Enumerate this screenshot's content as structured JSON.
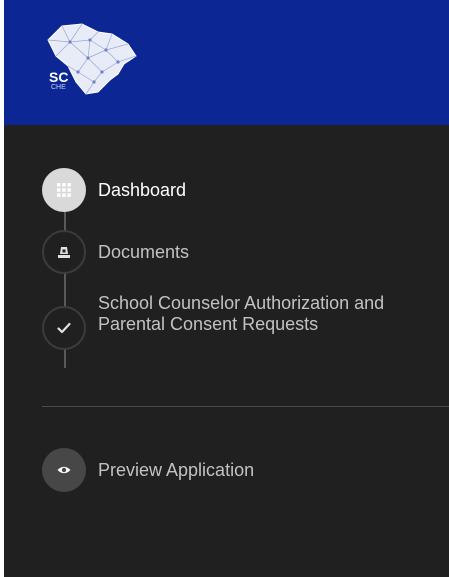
{
  "brand": {
    "abbr": "SC",
    "sub": "CHE",
    "bar_color": "#0c2793"
  },
  "nav": {
    "items": [
      {
        "label": "Dashboard",
        "icon": "grid-icon",
        "active": true
      },
      {
        "label": "Documents",
        "icon": "document-icon",
        "active": false
      },
      {
        "label": "School Counselor Authorization and Parental Consent Requests",
        "icon": "checkmark-icon",
        "active": false
      }
    ]
  },
  "preview": {
    "label": "Preview Application",
    "icon": "eye-icon"
  },
  "colors": {
    "sidebar_bg": "#202020",
    "active_circle": "#d9d9d9",
    "text": "#c2c2c2",
    "active_text": "#ffffff"
  }
}
